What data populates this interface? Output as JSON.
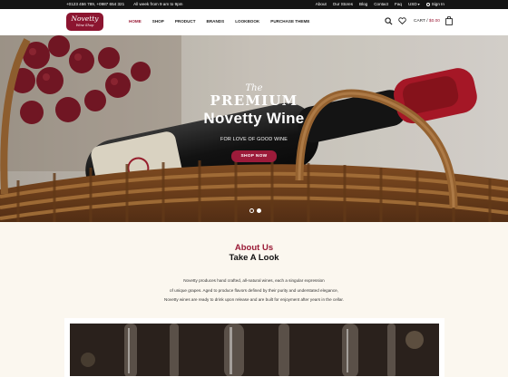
{
  "topbar": {
    "phones": "+0123 456 789, +0987 654 321",
    "hours": "All week from 9 am to 9pm",
    "links": [
      "About",
      "Our Stores",
      "Blog",
      "Contact",
      "Faq"
    ],
    "currency": "USD",
    "signin": "Sign In"
  },
  "logo": {
    "name": "Novetty",
    "sub": "Wine Shop"
  },
  "nav": [
    "HOME",
    "SHOP",
    "PRODUCT",
    "BRANDS",
    "LOOKBOOK",
    "PURCHASE THEME"
  ],
  "cart": {
    "label": "CART /",
    "amount": "$0.00"
  },
  "hero": {
    "the": "The",
    "premium": "PREMIUM",
    "title": "Novetty Wine",
    "tagline": "FOR LOVE OF GOOD WINE",
    "button": "SHOP NOW",
    "slide_count": 2,
    "active_slide": 2
  },
  "about": {
    "kicker": "About Us",
    "title": "Take A Look",
    "lines": [
      "Novetty produces hand crafted, all-natural wines, each a singular expression",
      "of unique grapes. Aged to produce flavors defined by their purity and understated elegance,",
      "Novetty wines are ready to drink upon release and are built for enjoyment after years in the cellar."
    ]
  },
  "colors": {
    "accent": "#9a1a36",
    "topbar": "#141414",
    "background": "#fbf7ef"
  }
}
